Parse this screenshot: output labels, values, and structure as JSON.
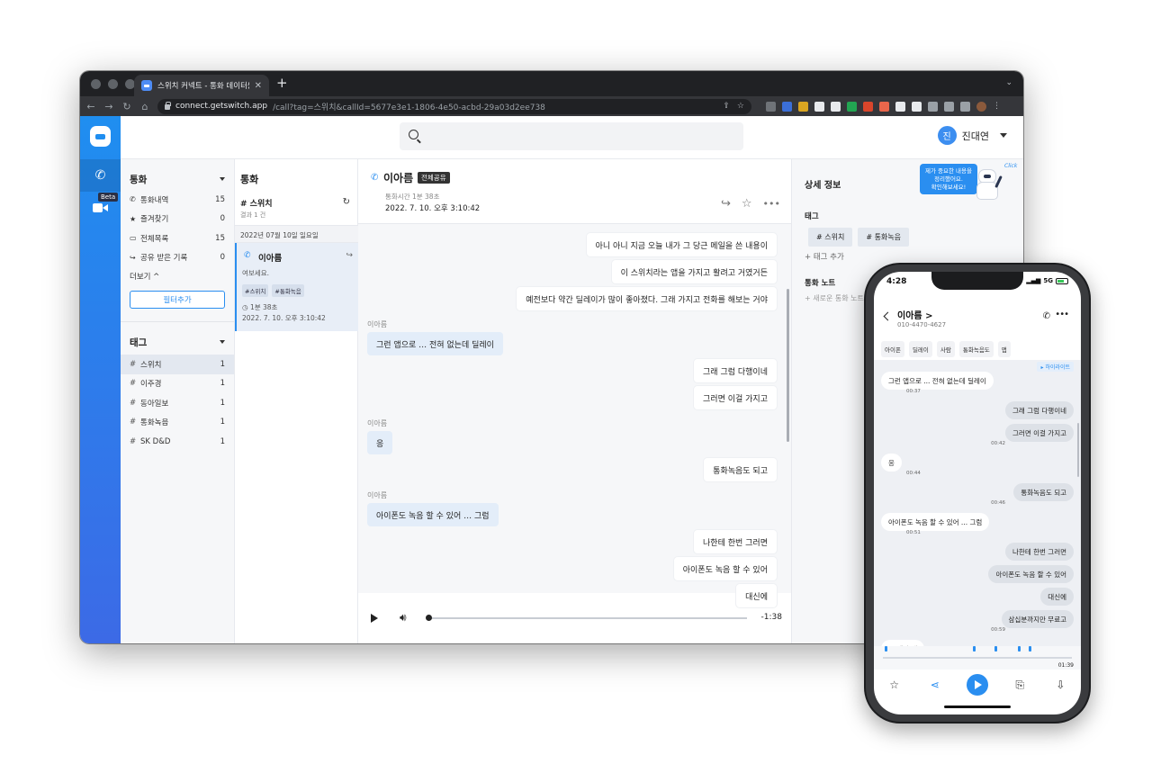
{
  "browser": {
    "tab_title": "스위치 커넥트 - 통화 데이터를 관리하",
    "url_host": "connect.getswitch.app",
    "url_path": "/call?tag=스위치&callId=5677e3e1-1806-4e50-acbd-29a03d2ee738"
  },
  "app": {
    "user": {
      "avatar_initial": "진",
      "name": "진대연"
    },
    "rail": {
      "beta_label": "Beta"
    },
    "calls_section": {
      "title": "통화",
      "items": [
        {
          "icon": "phone-icon",
          "label": "통화내역",
          "count": "15"
        },
        {
          "icon": "star-icon",
          "label": "즐겨찾기",
          "count": "0"
        },
        {
          "icon": "inbox-icon",
          "label": "전체목록",
          "count": "15"
        },
        {
          "icon": "share-icon",
          "label": "공유 받은 기록",
          "count": "0"
        }
      ],
      "more_label": "더보기",
      "filter_button": "필터추가"
    },
    "tags_section": {
      "title": "태그",
      "items": [
        {
          "label": "스위치",
          "count": "1",
          "active": true
        },
        {
          "label": "이주경",
          "count": "1"
        },
        {
          "label": "동아일보",
          "count": "1"
        },
        {
          "label": "통화녹음",
          "count": "1"
        },
        {
          "label": "SK D&D",
          "count": "1"
        }
      ]
    },
    "call_list": {
      "title": "통화",
      "tag_filter": "# 스위치",
      "result_count": "결과 1 건",
      "date_header": "2022년 07월 10일 일요일",
      "card": {
        "name": "이아름",
        "preview": "여보세요.",
        "tags": [
          "#스위치",
          "#통화녹음"
        ],
        "duration": "1분 38초",
        "datetime": "2022. 7. 10. 오후 3:10:42"
      }
    },
    "conversation": {
      "name": "이아름",
      "badge": "전체공유",
      "duration": "통화시간 1분 38초",
      "datetime": "2022. 7. 10. 오후 3:10:42",
      "messages": [
        {
          "side": "me",
          "text": "아니 아니 지금 오늘 내가 그 당근 메일을 쓴 내용이"
        },
        {
          "side": "me",
          "text": "이 스위치라는 앱을 가지고 활려고 거였거든"
        },
        {
          "side": "me",
          "text": "예전보다 약간 딜레이가 많이 좋아졌다. 그래 가지고 전화를 해보는 거야"
        },
        {
          "side": "speaker",
          "text": "이아름"
        },
        {
          "side": "them",
          "text": "그런 앱으로 … 전혀 없는데 딜레이"
        },
        {
          "side": "me",
          "text": "그래 그럼 다행이네"
        },
        {
          "side": "me",
          "text": "그러면 이걸 가지고"
        },
        {
          "side": "speaker",
          "text": "이아름"
        },
        {
          "side": "them",
          "text": "응"
        },
        {
          "side": "me",
          "text": "통화녹음도 되고"
        },
        {
          "side": "speaker",
          "text": "이아름"
        },
        {
          "side": "them",
          "text": "아이폰도 녹음 할 수 있어 … 그럼"
        },
        {
          "side": "me",
          "text": "나한테 한번 그러면"
        },
        {
          "side": "me",
          "text": "아이폰도 녹음 할 수 있어"
        },
        {
          "side": "me",
          "text": "대신에"
        }
      ],
      "player": {
        "remaining": "-1:38",
        "progress": 0.0
      }
    },
    "detail": {
      "title": "상세 정보",
      "tags_heading": "태그",
      "tags": [
        "# 스위치",
        "# 통화녹음"
      ],
      "add_tag": "+ 태그 추가",
      "note_heading": "통화 노트",
      "add_note": "+ 새로운 통화 노트",
      "promo_line1": "제가 중요한 내용을",
      "promo_line2": "정리했어요.",
      "promo_line3": "확인해보세요!",
      "click_text": "Click"
    }
  },
  "phone": {
    "time": "4:28",
    "network": "5G",
    "contact_name": "이아름 >",
    "contact_number": "010-4470-4627",
    "chips": [
      "아이폰",
      "딜레이",
      "사람",
      "통화녹음도",
      "앱"
    ],
    "highlight_label": "하이라이트",
    "messages": [
      {
        "side": "l",
        "text": "그런 앱으로 ... 전혀 없는데 딜레이",
        "time": "00:37"
      },
      {
        "side": "r",
        "text": "그래 그럼 다행이네",
        "time": ""
      },
      {
        "side": "r",
        "text": "그러면 이걸 가지고",
        "time": "00:42"
      },
      {
        "side": "l",
        "text": "응",
        "time": "00:44"
      },
      {
        "side": "r",
        "text": "통화녹음도 되고",
        "time": "00:46"
      },
      {
        "side": "l",
        "text": "아이폰도 녹음 할 수 있어 ... 그럼",
        "time": "00:51"
      },
      {
        "side": "r",
        "text": "나한테 한번 그러면",
        "time": ""
      },
      {
        "side": "r",
        "text": "아이폰도 녹음 할 수 있어",
        "time": ""
      },
      {
        "side": "r",
        "text": "대신에",
        "time": ""
      },
      {
        "side": "r",
        "text": "삼십분까지만 무료고",
        "time": "00:59"
      },
      {
        "side": "l",
        "text": "돈 내야 돼",
        "time": ""
      }
    ],
    "total_duration": "01:39"
  }
}
